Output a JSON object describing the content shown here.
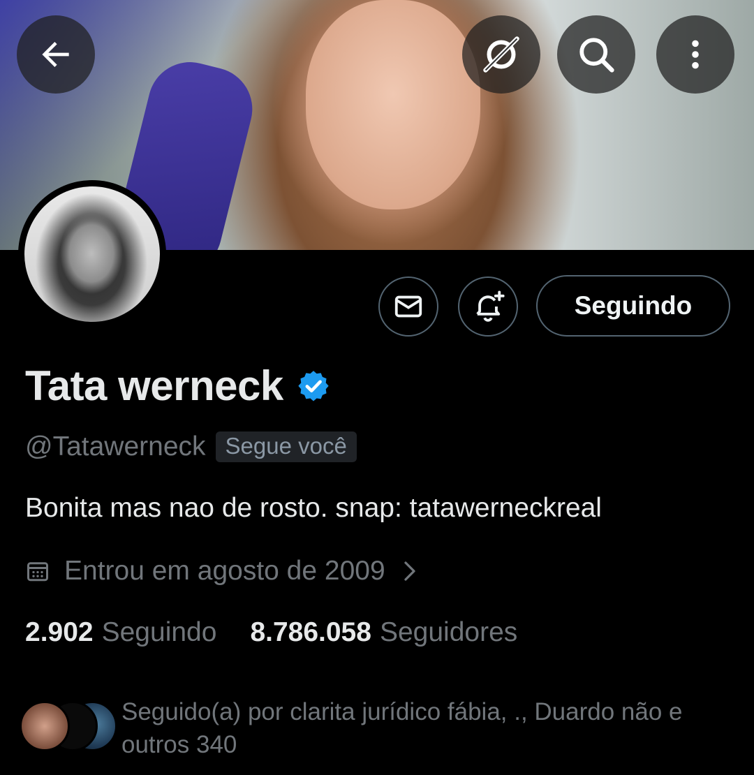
{
  "header": {
    "back_icon": "arrow-left-icon",
    "grok_icon": "grok-icon",
    "search_icon": "search-icon",
    "more_icon": "more-vertical-icon"
  },
  "actions": {
    "message_icon": "envelope-icon",
    "notify_icon": "bell-plus-icon",
    "follow_label": "Seguindo"
  },
  "profile": {
    "name": "Tata werneck",
    "verified_icon": "verified-badge-icon",
    "handle": "@Tatawerneck",
    "follows_you": "Segue você",
    "bio": "Bonita mas nao de rosto. snap: tatawerneckreal",
    "joined": "Entrou em agosto de 2009",
    "following_count": "2.902",
    "following_label": "Seguindo",
    "followers_count": "8.786.058",
    "followers_label": "Seguidores",
    "followed_by_line1": "Seguido(a) por clarita jurídico fábia, ., Duardo não e",
    "followed_by_line2": "outros 340"
  },
  "colors": {
    "background": "#000000",
    "text_primary": "#e7e9ea",
    "text_secondary": "#71767b",
    "border": "#536471",
    "verified": "#1d9bf0"
  }
}
